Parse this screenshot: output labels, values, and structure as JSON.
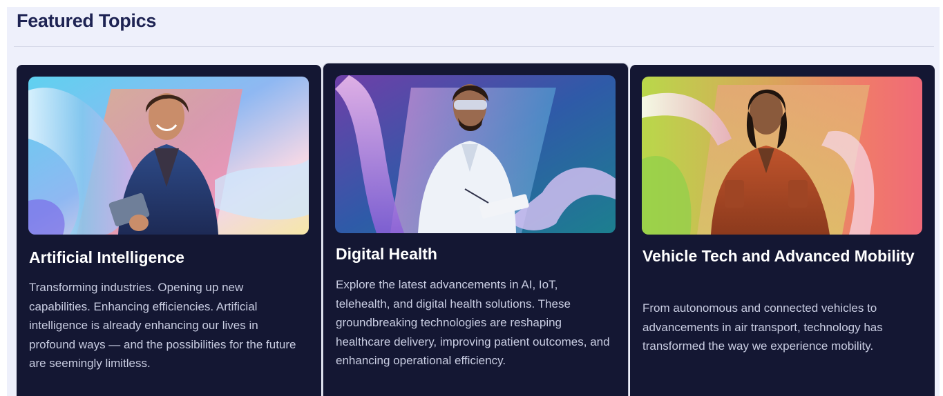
{
  "section": {
    "title": "Featured Topics"
  },
  "cards": [
    {
      "title": "Artificial Intelligence",
      "description": "Transforming industries. Opening up new capabilities. Enhancing efficiencies. Artificial intelligence is already enhancing our lives in profound ways — and the possibilities for the future are seemingly limitless.",
      "image_icon": "person-with-tablet-illustration"
    },
    {
      "title": "Digital Health",
      "description": "Explore the latest advancements in AI, IoT, telehealth, and digital health solutions. These groundbreaking technologies are reshaping healthcare delivery, improving patient outcomes, and enhancing operational efficiency.",
      "image_icon": "scientist-with-goggles-illustration"
    },
    {
      "title": "Vehicle Tech and Advanced Mobility",
      "description": "From autonomous and connected vehicles to advancements in air transport, technology has transformed the way we experience mobility.",
      "image_icon": "mechanic-woman-illustration"
    }
  ],
  "colors": {
    "panel_bg": "#eef0fb",
    "card_bg": "#141733",
    "title_color": "#1e2353",
    "card_text": "#c9cde2"
  }
}
